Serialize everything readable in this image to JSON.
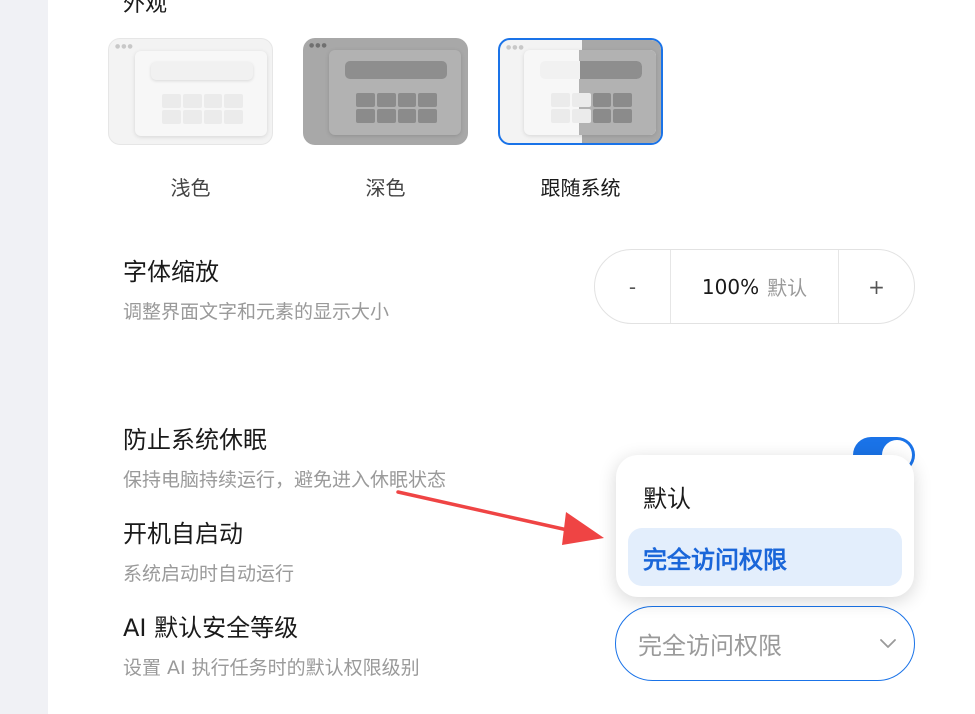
{
  "appearance": {
    "section_title": "外观",
    "themes": [
      {
        "label": "浅色",
        "selected": false
      },
      {
        "label": "深色",
        "selected": false
      },
      {
        "label": "跟随系统",
        "selected": true
      }
    ]
  },
  "font_scale": {
    "title": "字体缩放",
    "desc": "调整界面文字和元素的显示大小",
    "minus": "-",
    "value": "100%",
    "default_tag": "默认",
    "plus": "+"
  },
  "prevent_sleep": {
    "title": "防止系统休眠",
    "desc": "保持电脑持续运行，避免进入休眠状态",
    "enabled": true
  },
  "autostart": {
    "title": "开机自启动",
    "desc": "系统启动时自动运行"
  },
  "ai_security": {
    "title": "AI 默认安全等级",
    "desc": "设置 AI 执行任务时的默认权限级别",
    "selected_value": "完全访问权限",
    "options": [
      "默认",
      "完全访问权限"
    ]
  },
  "colors": {
    "accent": "#1a73e8",
    "annotation_arrow": "#ef4444"
  }
}
